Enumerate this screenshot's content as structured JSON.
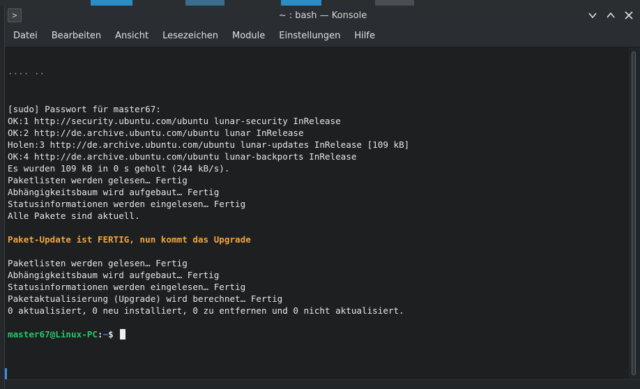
{
  "window": {
    "title": "~ : bash — Konsole",
    "app_icon_glyph": ">"
  },
  "menu": {
    "items": [
      "Datei",
      "Bearbeiten",
      "Ansicht",
      "Lesezeichen",
      "Module",
      "Einstellungen",
      "Hilfe"
    ]
  },
  "terminal": {
    "partial_line": "···· ··",
    "lines": [
      "[sudo] Passwort für master67:",
      "OK:1 http://security.ubuntu.com/ubuntu lunar-security InRelease",
      "OK:2 http://de.archive.ubuntu.com/ubuntu lunar InRelease",
      "Holen:3 http://de.archive.ubuntu.com/ubuntu lunar-updates InRelease [109 kB]",
      "OK:4 http://de.archive.ubuntu.com/ubuntu lunar-backports InRelease",
      "Es wurden 109 kB in 0 s geholt (244 kB/s).",
      "Paketlisten werden gelesen… Fertig",
      "Abhängigkeitsbaum wird aufgebaut… Fertig",
      "Statusinformationen werden eingelesen… Fertig",
      "Alle Pakete sind aktuell.",
      "",
      "Paket-Update ist FERTIG, nun kommt das Upgrade",
      "",
      "Paketlisten werden gelesen… Fertig",
      "Abhängigkeitsbaum wird aufgebaut… Fertig",
      "Statusinformationen werden eingelesen… Fertig",
      "Paketaktualisierung (Upgrade) wird berechnet… Fertig",
      "0 aktualisiert, 0 neu installiert, 0 zu entfernen und 0 nicht aktualisiert.",
      ""
    ],
    "highlight_line_index": 11,
    "prompt": {
      "user_host": "master67@Linux-PC",
      "colon": ":",
      "path": "~",
      "symbol": "$"
    }
  },
  "colors": {
    "background": "#1d1f21",
    "text": "#e6e6e6",
    "highlight": "#f0a53a",
    "prompt_user": "#29c46b",
    "prompt_path": "#3b8ee8"
  }
}
